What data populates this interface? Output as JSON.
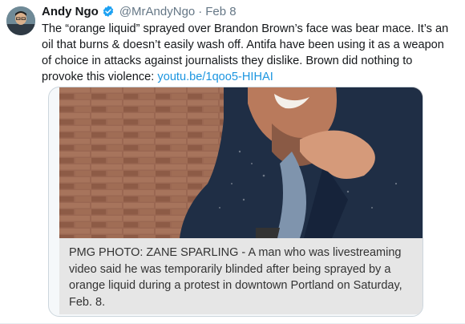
{
  "tweet": {
    "display_name": "Andy Ngo",
    "handle": "@MrAndyNgo",
    "separator": "·",
    "timestamp": "Feb 8",
    "body": "The “orange liquid” sprayed over Brandon Brown’s face was bear mace. It’s an oil that burns & doesn’t easily wash off. Antifa have been using it as a weapon of choice in attacks against journalists they dislike. Brown did nothing to provoke this violence:",
    "link_text": "youtu.be/1qoo5-HIHAI"
  },
  "card": {
    "caption": "PMG PHOTO: ZANE SPARLING - A man who was livestreaming video said he was temporarily blinded after being sprayed by a orange liquid during a protest in downtown Portland on Saturday, Feb. 8."
  },
  "colors": {
    "link": "#1b95e0",
    "verified": "#1da1f2",
    "muted": "#657786"
  },
  "icons": {
    "verified": "verified-badge-icon"
  }
}
